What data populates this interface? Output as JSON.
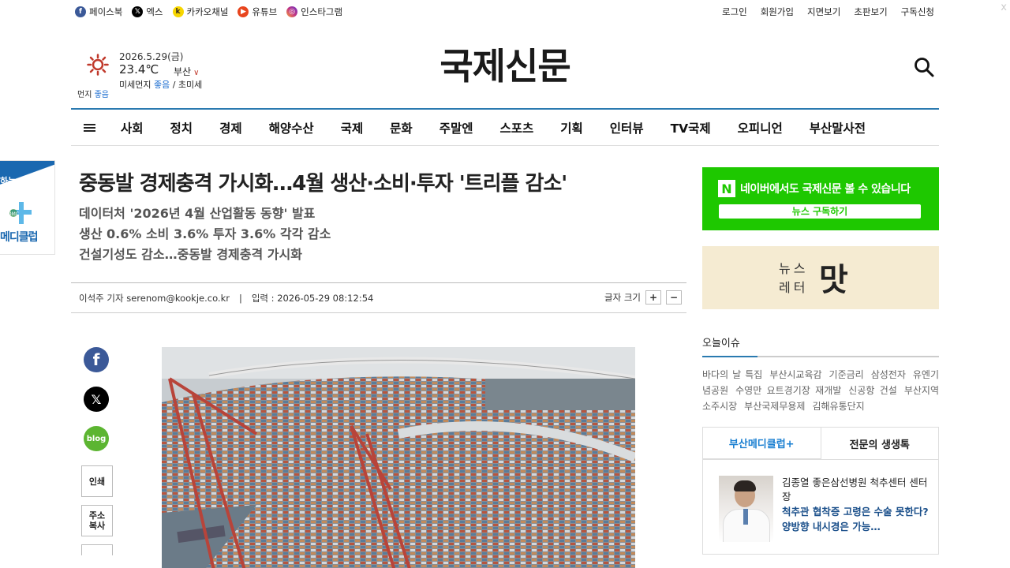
{
  "social": [
    {
      "label": "페이스북",
      "icon": "facebook-icon",
      "color": "#3b5998"
    },
    {
      "label": "엑스",
      "icon": "x-icon",
      "color": "#000000"
    },
    {
      "label": "카카오채널",
      "icon": "kakao-icon",
      "color": "#f7d600"
    },
    {
      "label": "유튜브",
      "icon": "youtube-icon",
      "color": "#e8451d"
    },
    {
      "label": "인스타그램",
      "icon": "instagram-icon",
      "color": "#c13584"
    }
  ],
  "util": [
    "로그인",
    "회원가입",
    "지면보기",
    "초판보기",
    "구독신청"
  ],
  "weather": {
    "date": "2026.5.29(금)",
    "temp": "23.4℃",
    "city": "부산",
    "dust_label": "미세먼지",
    "dust_value": "좋음",
    "dust_sep": " / 초미세",
    "dust2_label": "먼지",
    "dust2_value": "좋음"
  },
  "logo": "국제신문",
  "nav": [
    "사회",
    "정치",
    "경제",
    "해양수산",
    "국제",
    "문화",
    "주말엔",
    "스포츠",
    "기획",
    "인터뷰",
    "TV국제",
    "오피니언",
    "부산말사전"
  ],
  "leftad": {
    "line1": "하는",
    "line2": "메디클럽"
  },
  "article": {
    "headline": "중동발 경제충격 가시화…4월 생산·소비·투자 '트리플 감소'",
    "subtitles": [
      "데이터처 '2026년 4월 산업활동 동향' 발표",
      "생산 0.6% 소비 3.6% 투자 3.6% 각각 감소",
      "건설기성도 감소…중동발 경제충격 가시화"
    ],
    "byline": "이석주 기자 serenom@kookje.co.kr",
    "date": "입력 : 2026-05-29 08:12:54",
    "fontsize_label": "글자 크기",
    "plus": "+",
    "minus": "−"
  },
  "share": {
    "blog": "blog",
    "print": "인쇄",
    "copy": "주소\n복사"
  },
  "right": {
    "naver_text": "네이버에서도 국제신문 볼 수 있습니다",
    "naver_btn": "뉴스 구독하기",
    "newsletter_l1": "뉴스",
    "newsletter_l2": "레터",
    "newsletter_brand": "맛",
    "issue_title": "오늘이슈",
    "issue_tags": [
      "바다의 날 특집",
      "부산시교육감",
      "기준금리",
      "삼성전자",
      "유엔기념공원",
      "수영만 요트경기장 재개발",
      "신공항 건설",
      "부산지역 소주시장",
      "부산국제무용제",
      "김해유통단지"
    ],
    "tab_active": "부산메디클럽+",
    "tab_inactive": "전문의 생생톡",
    "doc_name": "김종열 좋은삼선병원 척추센터 센터장",
    "doc_q": "척추관 협착증 고령은 수술 못한다? 양방향 내시경은 가능…"
  }
}
